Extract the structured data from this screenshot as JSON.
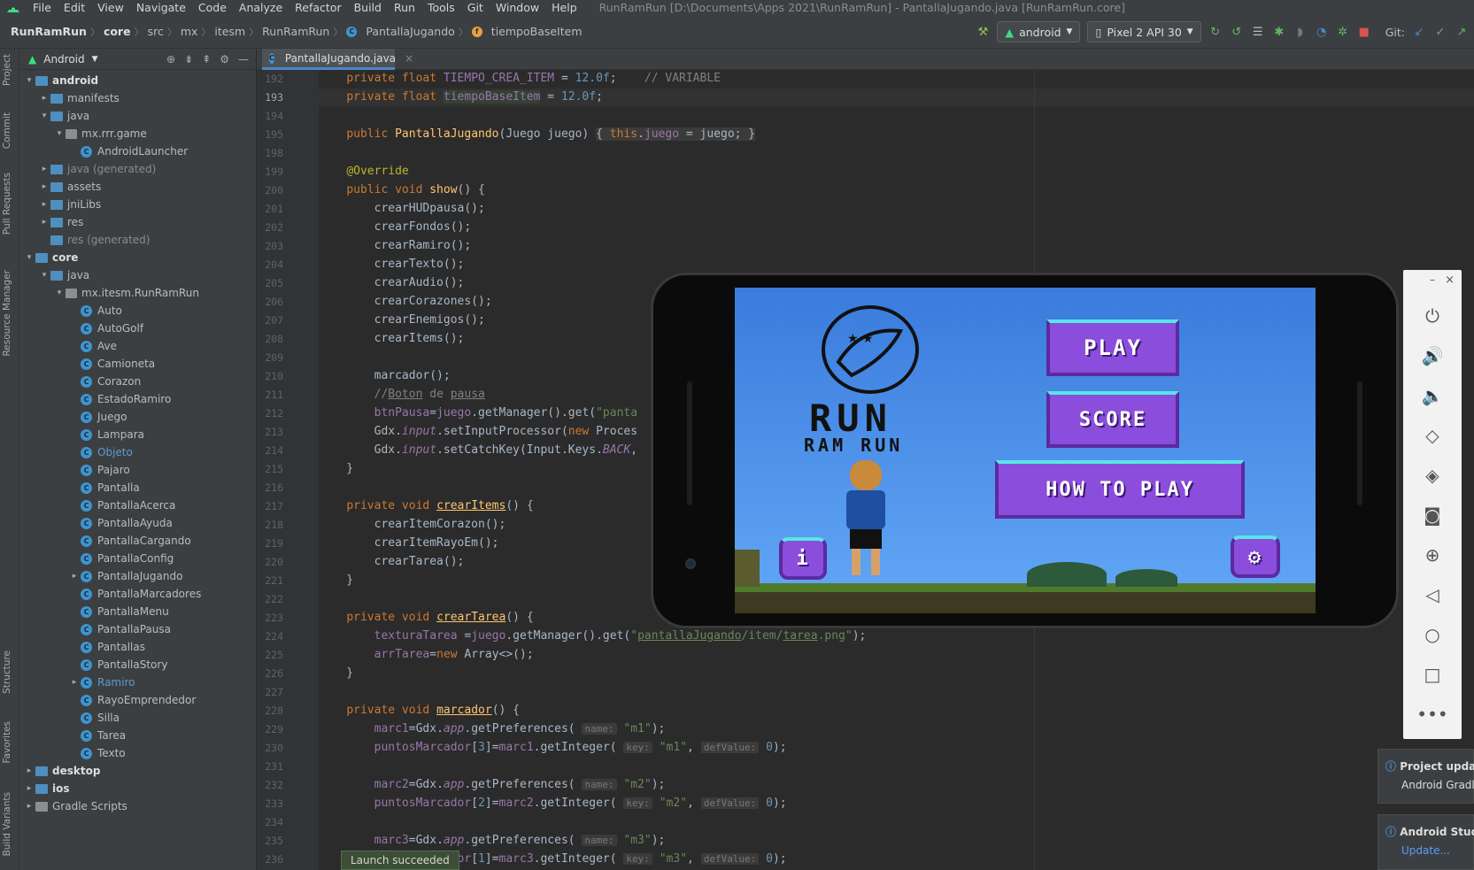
{
  "menu": [
    "File",
    "Edit",
    "View",
    "Navigate",
    "Code",
    "Analyze",
    "Refactor",
    "Build",
    "Run",
    "Tools",
    "Git",
    "Window",
    "Help"
  ],
  "window_title": "RunRamRun [D:\\Documents\\Apps 2021\\RunRamRun] - PantallaJugando.java [RunRamRun.core]",
  "breadcrumbs": [
    "RunRamRun",
    "core",
    "src",
    "mx",
    "itesm",
    "RunRamRun",
    "PantallaJugando",
    "tiempoBaseItem"
  ],
  "run_config": "android",
  "device": "Pixel 2 API 30",
  "git_label": "Git:",
  "project_view": "Android",
  "tree": [
    {
      "label": "android",
      "depth": 0,
      "arrow": "▾",
      "type": "folder",
      "style": "bold"
    },
    {
      "label": "manifests",
      "depth": 1,
      "arrow": "▸",
      "type": "folder"
    },
    {
      "label": "java",
      "depth": 1,
      "arrow": "▾",
      "type": "folder"
    },
    {
      "label": "mx.rrr.game",
      "depth": 2,
      "arrow": "▾",
      "type": "pkg"
    },
    {
      "label": "AndroidLauncher",
      "depth": 3,
      "arrow": "",
      "type": "class"
    },
    {
      "label": "java (generated)",
      "depth": 1,
      "arrow": "▸",
      "type": "folder",
      "style": "muted"
    },
    {
      "label": "assets",
      "depth": 1,
      "arrow": "▸",
      "type": "folder"
    },
    {
      "label": "jniLibs",
      "depth": 1,
      "arrow": "▸",
      "type": "folder"
    },
    {
      "label": "res",
      "depth": 1,
      "arrow": "▸",
      "type": "folder"
    },
    {
      "label": "res (generated)",
      "depth": 1,
      "arrow": "",
      "type": "folder",
      "style": "muted"
    },
    {
      "label": "core",
      "depth": 0,
      "arrow": "▾",
      "type": "folder",
      "style": "bold"
    },
    {
      "label": "java",
      "depth": 1,
      "arrow": "▾",
      "type": "folder"
    },
    {
      "label": "mx.itesm.RunRamRun",
      "depth": 2,
      "arrow": "▾",
      "type": "pkg"
    },
    {
      "label": "Auto",
      "depth": 3,
      "arrow": "",
      "type": "class"
    },
    {
      "label": "AutoGolf",
      "depth": 3,
      "arrow": "",
      "type": "class"
    },
    {
      "label": "Ave",
      "depth": 3,
      "arrow": "",
      "type": "class"
    },
    {
      "label": "Camioneta",
      "depth": 3,
      "arrow": "",
      "type": "class"
    },
    {
      "label": "Corazon",
      "depth": 3,
      "arrow": "",
      "type": "class"
    },
    {
      "label": "EstadoRamiro",
      "depth": 3,
      "arrow": "",
      "type": "class"
    },
    {
      "label": "Juego",
      "depth": 3,
      "arrow": "",
      "type": "class"
    },
    {
      "label": "Lampara",
      "depth": 3,
      "arrow": "",
      "type": "class"
    },
    {
      "label": "Objeto",
      "depth": 3,
      "arrow": "",
      "type": "class",
      "style": "blue"
    },
    {
      "label": "Pajaro",
      "depth": 3,
      "arrow": "",
      "type": "class"
    },
    {
      "label": "Pantalla",
      "depth": 3,
      "arrow": "",
      "type": "class"
    },
    {
      "label": "PantallaAcerca",
      "depth": 3,
      "arrow": "",
      "type": "class"
    },
    {
      "label": "PantallaAyuda",
      "depth": 3,
      "arrow": "",
      "type": "class"
    },
    {
      "label": "PantallaCargando",
      "depth": 3,
      "arrow": "",
      "type": "class"
    },
    {
      "label": "PantallaConfig",
      "depth": 3,
      "arrow": "",
      "type": "class"
    },
    {
      "label": "PantallaJugando",
      "depth": 3,
      "arrow": "▸",
      "type": "class"
    },
    {
      "label": "PantallaMarcadores",
      "depth": 3,
      "arrow": "",
      "type": "class"
    },
    {
      "label": "PantallaMenu",
      "depth": 3,
      "arrow": "",
      "type": "class"
    },
    {
      "label": "PantallaPausa",
      "depth": 3,
      "arrow": "",
      "type": "class"
    },
    {
      "label": "Pantallas",
      "depth": 3,
      "arrow": "",
      "type": "class"
    },
    {
      "label": "PantallaStory",
      "depth": 3,
      "arrow": "",
      "type": "class"
    },
    {
      "label": "Ramiro",
      "depth": 3,
      "arrow": "▸",
      "type": "class",
      "style": "blue"
    },
    {
      "label": "RayoEmprendedor",
      "depth": 3,
      "arrow": "",
      "type": "class"
    },
    {
      "label": "Silla",
      "depth": 3,
      "arrow": "",
      "type": "class"
    },
    {
      "label": "Tarea",
      "depth": 3,
      "arrow": "",
      "type": "class"
    },
    {
      "label": "Texto",
      "depth": 3,
      "arrow": "",
      "type": "class"
    },
    {
      "label": "desktop",
      "depth": 0,
      "arrow": "▸",
      "type": "folder",
      "style": "bold"
    },
    {
      "label": "ios",
      "depth": 0,
      "arrow": "▸",
      "type": "folder",
      "style": "bold"
    },
    {
      "label": "Gradle Scripts",
      "depth": 0,
      "arrow": "▸",
      "type": "gradle"
    }
  ],
  "editor_tab": "PantallaJugando.java",
  "toast": "Launch succeeded",
  "notifications": [
    {
      "title": "Project updat",
      "body": "Android Gradl"
    },
    {
      "title": "Android Studi",
      "body": "Update..."
    }
  ],
  "game": {
    "title1": "RUN",
    "title2": "RAM RUN",
    "play": "PLAY",
    "score": "SCORE",
    "howto": "HOW TO PLAY"
  },
  "side_tabs": [
    "Project",
    "Commit",
    "Pull Requests",
    "Resource Manager",
    "Structure",
    "Favorites",
    "Build Variants"
  ]
}
